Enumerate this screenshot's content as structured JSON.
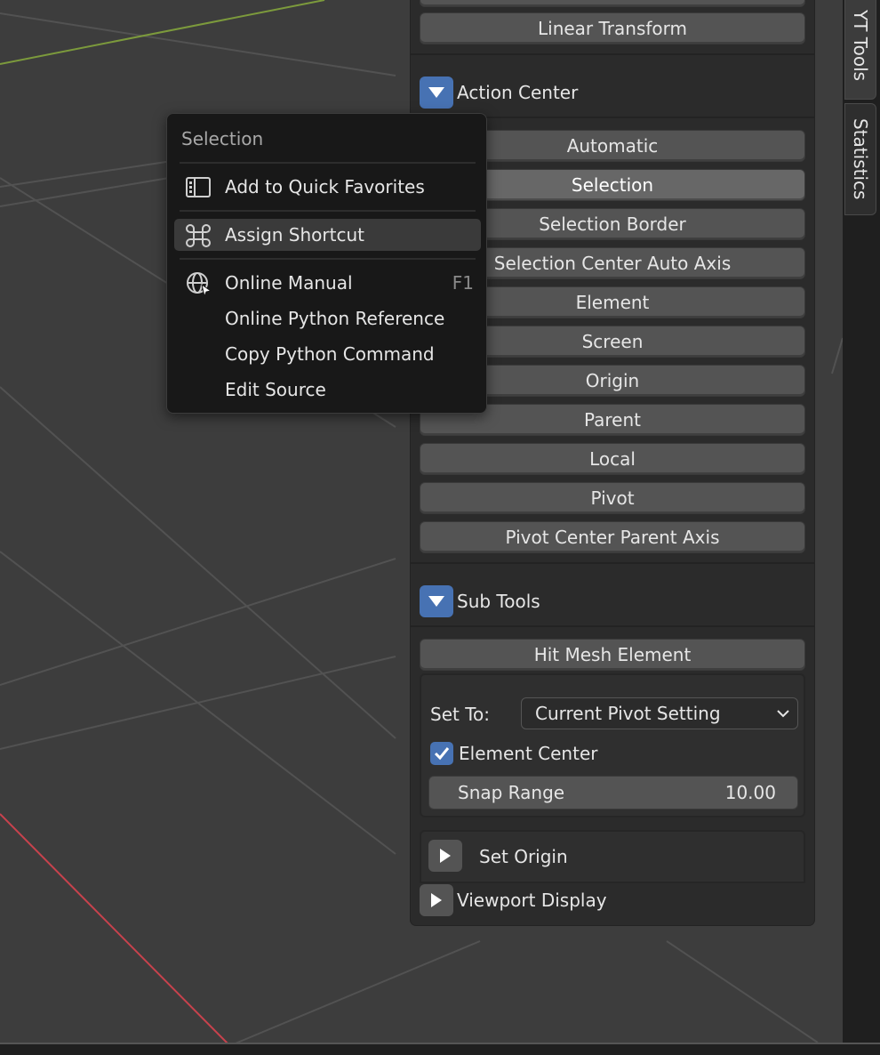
{
  "context_menu": {
    "title": "Selection",
    "items": [
      {
        "label": "Add to Quick Favorites",
        "icon": "quick-favorites-icon"
      },
      {
        "label": "Assign Shortcut",
        "icon": "shortcut-command-icon"
      },
      {
        "label": "Online Manual",
        "icon": "globe-cursor-icon",
        "shortcut": "F1"
      },
      {
        "label": "Online Python Reference"
      },
      {
        "label": "Copy Python Command"
      },
      {
        "label": "Edit Source"
      }
    ]
  },
  "panel": {
    "top_button": "Linear Transform",
    "action_center": {
      "header": "Action Center",
      "options": [
        "Automatic",
        "Selection",
        "Selection Border",
        "Selection Center Auto Axis",
        "Element",
        "Screen",
        "Origin",
        "Parent",
        "Local",
        "Pivot",
        "Pivot Center Parent Axis"
      ],
      "active": "Selection"
    },
    "sub_tools": {
      "header": "Sub Tools",
      "hit_button": "Hit Mesh Element",
      "set_to_label": "Set To:",
      "set_to_value": "Current Pivot Setting",
      "element_center_label": "Element Center",
      "element_center_checked": true,
      "snap_range_label": "Snap Range",
      "snap_range_value": "10.00"
    },
    "set_origin": "Set Origin",
    "viewport_display": "Viewport Display"
  },
  "side_tabs": [
    "YT Tools",
    "Statistics"
  ],
  "colors": {
    "accent": "#4772b3",
    "viewport_bg": "#3d3d3d",
    "axis_x": "#c8424d",
    "axis_y": "#7c9a3c"
  }
}
